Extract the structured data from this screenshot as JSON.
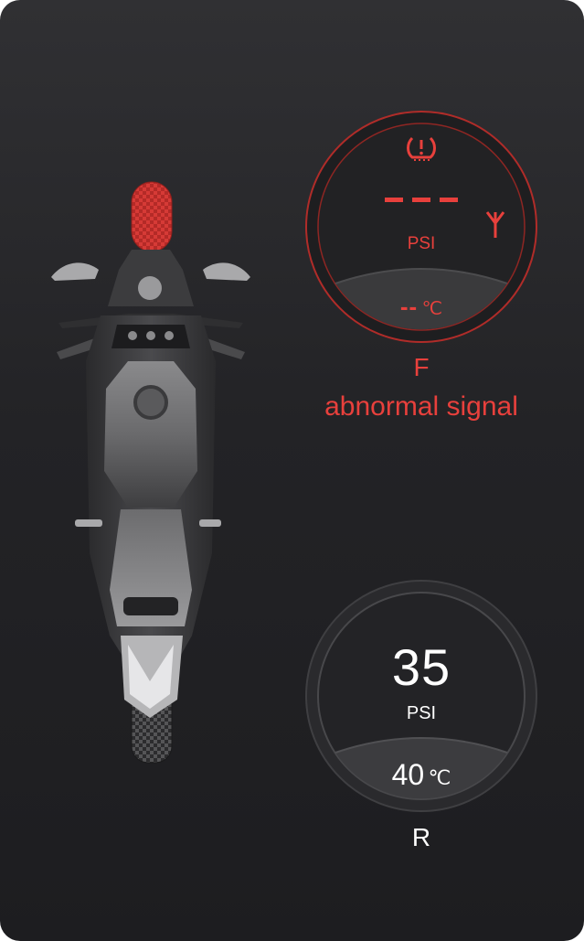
{
  "front": {
    "position": "F",
    "pressure": "---",
    "unit": "PSI",
    "temp_value": "--",
    "temp_unit": "℃",
    "status": "abnormal signal",
    "icons": [
      "tire-pressure-warning-icon",
      "signal-antenna-icon"
    ],
    "color": "#e8403c"
  },
  "rear": {
    "position": "R",
    "pressure": "35",
    "unit": "PSI",
    "temp_value": "40",
    "temp_unit": "℃",
    "color": "#ffffff"
  }
}
